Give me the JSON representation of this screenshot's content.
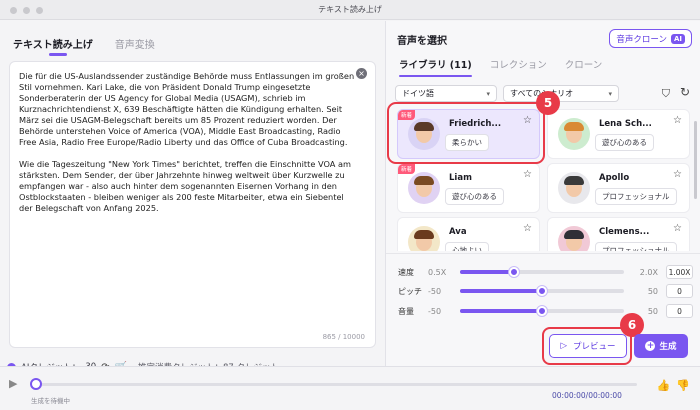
{
  "window": {
    "title": "テキスト読み上げ"
  },
  "left": {
    "tabs": [
      {
        "label": "テキスト読み上げ"
      },
      {
        "label": "音声変換"
      }
    ],
    "text": "Die für die US-Auslandssender zuständige Behörde muss Entlassungen im großen Stil vornehmen. Kari Lake, die von Präsident Donald Trump eingesetzte Sonderberaterin der US Agency for Global Media (USAGM), schrieb im Kurznachrichtendienst X, 639 Beschäftigte hätten die Kündigung erhalten. Seit März sei die USAGM-Belegschaft bereits um 85 Prozent reduziert worden. Der Behörde unterstehen Voice of America (VOA), Middle East Broadcasting, Radio Free Asia, Radio Free Europe/Radio Liberty und das Office of Cuba Broadcasting.\n\nWie die Tageszeitung \"New York Times\" berichtet, treffen die Einschnitte VOA am stärksten. Dem Sender, der über Jahrzehnte hinweg weltweit über Kurzwelle zu empfangen war - also auch hinter dem sogenannten Eisernen Vorhang in den Ostblockstaaten - bleiben weniger als 200 feste Mitarbeiter, etwa ein Siebentel der Belegschaft von Anfang 2025.",
    "char_count": "865 / 10000",
    "credits_label": "AIクレジット：",
    "credits_value": "30",
    "estimated": "推定消費クレジット：87 クレジット"
  },
  "right": {
    "title": "音声を選択",
    "clone_button": "音声クローン",
    "clone_badge": "AI",
    "tabs": [
      {
        "label": "ライブラリ  (11)"
      },
      {
        "label": "コレクション"
      },
      {
        "label": "クローン"
      }
    ],
    "language": "ドイツ語",
    "scenario": "すべてのシナリオ",
    "voices": [
      {
        "name": "Friedrich...",
        "tag": "柔らかい",
        "new_badge": "新着",
        "hair": "#5a3a28",
        "bg": "#d9d3f5"
      },
      {
        "name": "Lena Sch...",
        "tag": "遊び心のある",
        "new_badge": "",
        "hair": "#d98a34",
        "bg": "#cdeccf"
      },
      {
        "name": "Liam",
        "tag": "遊び心のある",
        "new_badge": "新着",
        "hair": "#7a4a22",
        "bg": "#e0d2f3"
      },
      {
        "name": "Apollo",
        "tag": "プロフェッショナル",
        "new_badge": "",
        "hair": "#3a3a3a",
        "bg": "#e8e8ec"
      },
      {
        "name": "Ava",
        "tag": "心地よい",
        "new_badge": "",
        "hair": "#6a3a1e",
        "bg": "#f3e7c8"
      },
      {
        "name": "Clemens...",
        "tag": "プロフェッショナル",
        "new_badge": "",
        "hair": "#2f2f36",
        "bg": "#f1c9d6"
      }
    ],
    "controls": [
      {
        "label": "速度",
        "min": "0.5X",
        "max": "2.0X",
        "value": "1.00X",
        "level": 0.33
      },
      {
        "label": "ピッチ",
        "min": "-50",
        "max": "50",
        "value": "0",
        "level": 0.5
      },
      {
        "label": "音量",
        "min": "-50",
        "max": "50",
        "value": "0",
        "level": 0.5
      }
    ],
    "preview_button": "プレビュー",
    "generate_button": "生成"
  },
  "callouts": {
    "voice": "5",
    "preview": "6"
  },
  "player": {
    "status": "生成を待機中",
    "time": "00:00:00/00:00:00"
  }
}
